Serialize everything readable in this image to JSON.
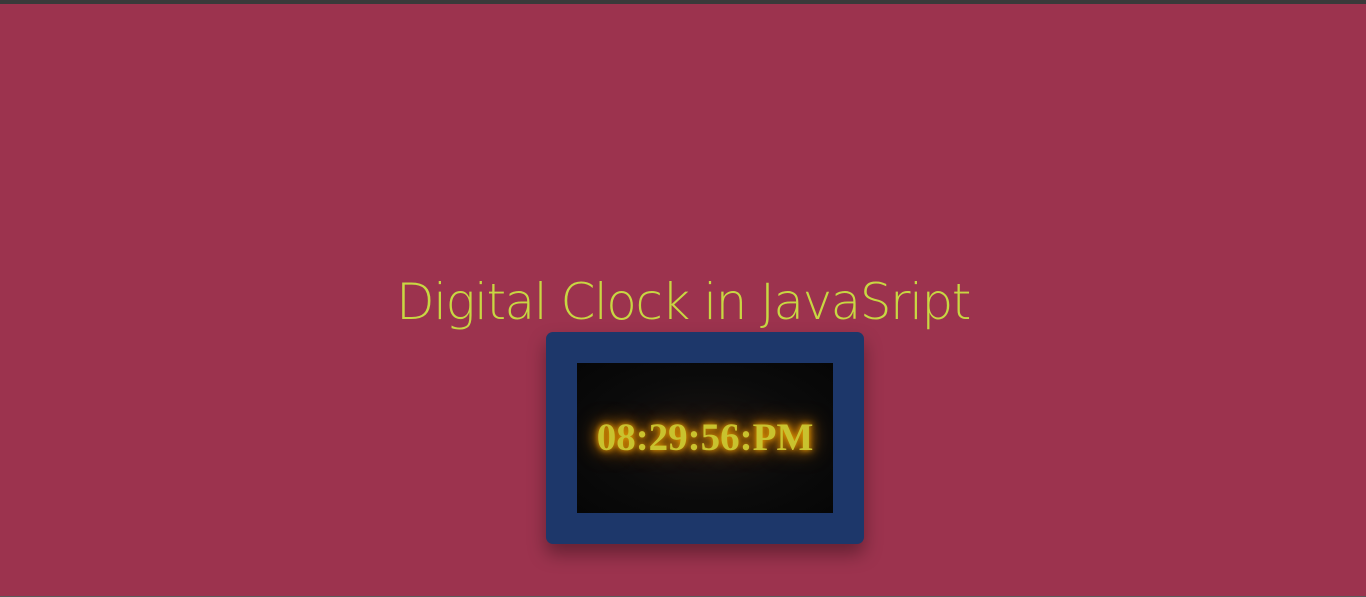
{
  "page": {
    "title": "Digital Clock in JavaSript"
  },
  "clock": {
    "time": "08:29:56:PM"
  },
  "colors": {
    "background": "#9c334e",
    "title": "#c8d742",
    "frame": "#1d376a",
    "screen": "#0b0b0b",
    "digits": "#c9c22e",
    "glow": "#f0a000"
  }
}
